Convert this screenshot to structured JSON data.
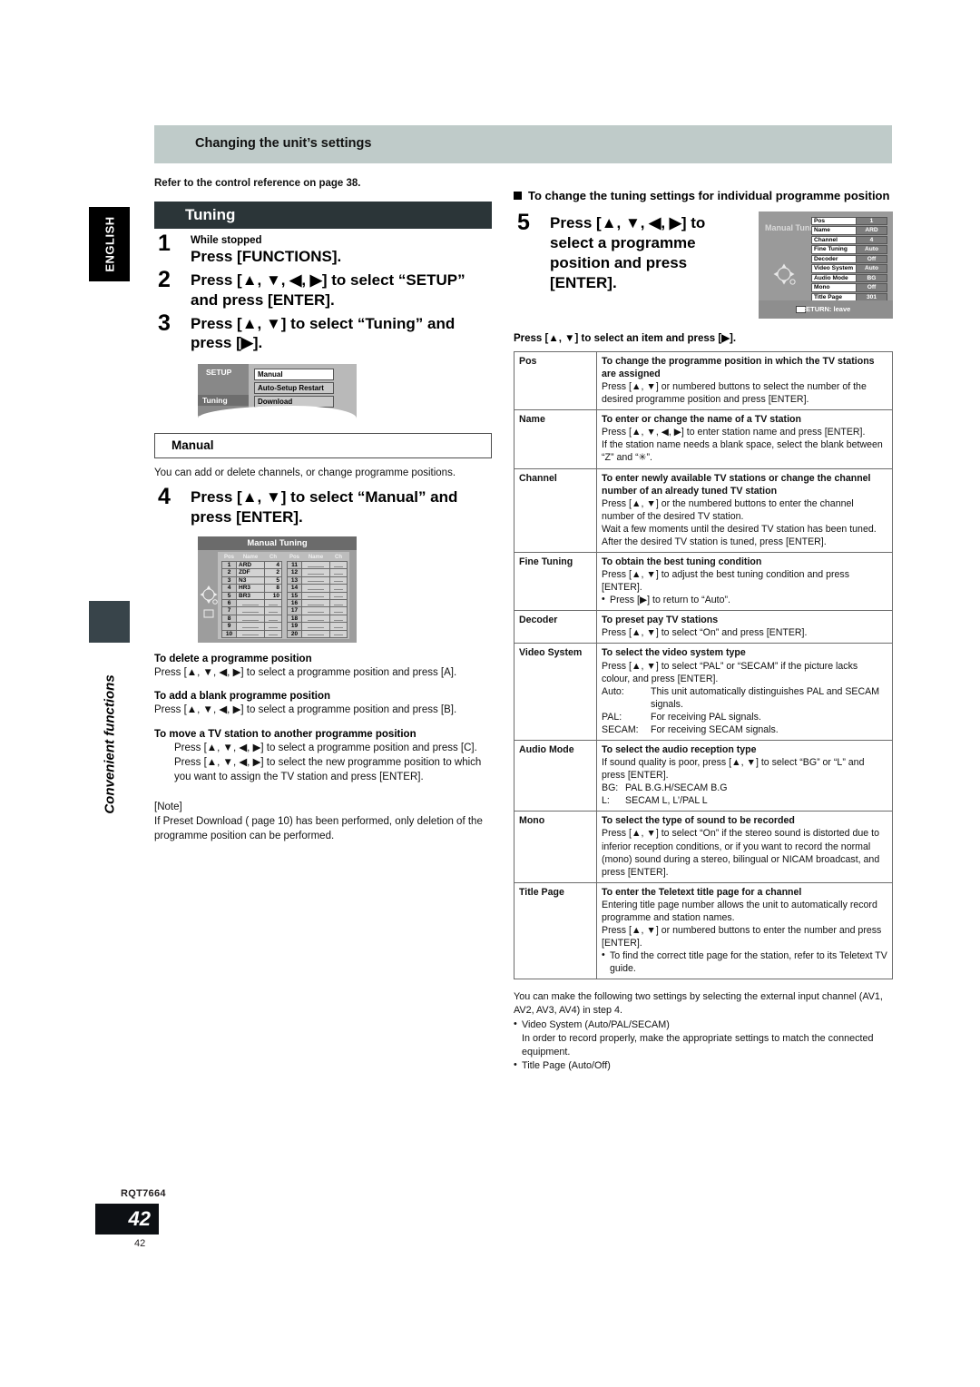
{
  "margin": {
    "language_tab": "ENGLISH",
    "chapter_label": "Convenient functions",
    "product_code": "RQT7664",
    "page_number": "42",
    "page_number_small": "42"
  },
  "header": {
    "band_title": "Changing the unit’s settings"
  },
  "left": {
    "reference_line": "Refer to the control reference on page 38.",
    "section_title": "Tuning",
    "steps": [
      {
        "num": "1",
        "sub": "While stopped",
        "text": "Press [FUNCTIONS]."
      },
      {
        "num": "2",
        "sub": "",
        "text": "Press [▲, ▼, ◀, ▶] to select “SETUP” and press [ENTER]."
      },
      {
        "num": "3",
        "sub": "",
        "text": "Press [▲, ▼] to select “Tuning” and press [▶]."
      }
    ],
    "setup_screen": {
      "title": "SETUP",
      "selected_category": "Tuning",
      "items": [
        "Manual",
        "Auto-Setup Restart",
        "Download"
      ]
    },
    "manual_box_title": "Manual",
    "manual_intro": "You can add or delete channels, or change programme positions.",
    "step4": {
      "num": "4",
      "text": "Press [▲, ▼] to select “Manual” and press [ENTER]."
    },
    "manual_tuning_screen": {
      "title": "Manual Tuning",
      "columns": [
        "Pos",
        "Name",
        "Ch"
      ],
      "rows_left": [
        {
          "pos": "1",
          "name": "ARD",
          "ch": "4"
        },
        {
          "pos": "2",
          "name": "ZDF",
          "ch": "2"
        },
        {
          "pos": "3",
          "name": "N3",
          "ch": "5"
        },
        {
          "pos": "4",
          "name": "HR3",
          "ch": "8"
        },
        {
          "pos": "5",
          "name": "BR3",
          "ch": "10"
        },
        {
          "pos": "6",
          "name": "",
          "ch": ""
        },
        {
          "pos": "7",
          "name": "",
          "ch": ""
        },
        {
          "pos": "8",
          "name": "",
          "ch": ""
        },
        {
          "pos": "9",
          "name": "",
          "ch": ""
        },
        {
          "pos": "10",
          "name": "",
          "ch": ""
        }
      ],
      "rows_right": [
        {
          "pos": "11",
          "name": "",
          "ch": ""
        },
        {
          "pos": "12",
          "name": "",
          "ch": ""
        },
        {
          "pos": "13",
          "name": "",
          "ch": ""
        },
        {
          "pos": "14",
          "name": "",
          "ch": ""
        },
        {
          "pos": "15",
          "name": "",
          "ch": ""
        },
        {
          "pos": "16",
          "name": "",
          "ch": ""
        },
        {
          "pos": "17",
          "name": "",
          "ch": ""
        },
        {
          "pos": "18",
          "name": "",
          "ch": ""
        },
        {
          "pos": "19",
          "name": "",
          "ch": ""
        },
        {
          "pos": "20",
          "name": "",
          "ch": ""
        }
      ]
    },
    "procedures": [
      {
        "heading": "To delete a programme position",
        "body": "Press [▲, ▼, ◀, ▶] to select a programme position and press [A]."
      },
      {
        "heading": "To add a blank programme position",
        "body": "Press [▲, ▼, ◀, ▶] to select a programme position and press [B]."
      },
      {
        "heading": "To move a TV station to another programme position",
        "body1": "Press [▲, ▼, ◀, ▶] to select a programme position and press [C].",
        "body2": "Press [▲, ▼, ◀, ▶] to select the new programme position to which you want to assign the TV station and press [ENTER]."
      }
    ],
    "note_label": "[Note]",
    "note_text": "If Preset Download (  page 10) has been performed, only deletion of the programme position can be performed."
  },
  "right": {
    "heading": "To change the tuning settings for individual programme position",
    "step5": {
      "num": "5",
      "text": "Press [▲, ▼, ◀, ▶] to select a programme position and press [ENTER]."
    },
    "tv_screen": {
      "title": "Manual Tuning",
      "settings": [
        {
          "key": "Pos",
          "value": "1"
        },
        {
          "key": "Name",
          "value": "ARD"
        },
        {
          "key": "Channel",
          "value": "4"
        },
        {
          "key": "Fine Tuning",
          "value": "Auto"
        },
        {
          "key": "Decoder",
          "value": "Off"
        },
        {
          "key": "Video System",
          "value": "Auto"
        },
        {
          "key": "Audio Mode",
          "value": "BG"
        },
        {
          "key": "Mono",
          "value": "Off"
        },
        {
          "key": "Title Page",
          "value": "301"
        }
      ],
      "footer": "RETURN:  leave"
    },
    "table_intro": "Press [▲, ▼] to select an item and press [▶].",
    "table": [
      {
        "key": "Pos",
        "title": "To change the programme position in which the TV stations are assigned",
        "lines": [
          "Press [▲, ▼] or numbered buttons to select the number of the desired programme position and press [ENTER]."
        ]
      },
      {
        "key": "Name",
        "title": "To enter or change the name of a TV station",
        "lines": [
          "Press [▲, ▼, ◀, ▶] to enter station name and press [ENTER].",
          "If the station name needs a blank space, select the blank between “Z” and “✳”."
        ]
      },
      {
        "key": "Channel",
        "title": "To enter newly available TV stations or change the channel number of an already tuned TV station",
        "lines": [
          "Press [▲, ▼] or the numbered buttons to enter the channel number of the desired TV station.",
          "Wait a few moments until the desired TV station has been tuned.",
          "After the desired TV station is tuned, press [ENTER]."
        ]
      },
      {
        "key": "Fine Tuning",
        "title": "To obtain the best tuning condition",
        "lines": [
          "Press [▲, ▼] to adjust the best tuning condition and press [ENTER]."
        ],
        "bullets": [
          "Press [▶] to return to “Auto”."
        ]
      },
      {
        "key": "Decoder",
        "title": "To preset pay TV stations",
        "lines": [
          "Press [▲, ▼] to select “On” and press [ENTER]."
        ]
      },
      {
        "key": "Video System",
        "title": "To select the video system type",
        "lines": [
          "Press [▲, ▼] to select “PAL” or “SECAM” if the picture lacks colour, and press [ENTER]."
        ],
        "defs": [
          {
            "term": "Auto:",
            "desc": "This unit automatically distinguishes PAL and SECAM signals."
          },
          {
            "term": "PAL:",
            "desc": "For receiving PAL signals."
          },
          {
            "term": "SECAM:",
            "desc": "For receiving SECAM signals."
          }
        ]
      },
      {
        "key": "Audio Mode",
        "title": "To select the audio reception type",
        "lines": [
          "If sound quality is poor, press [▲, ▼] to select “BG” or “L” and press [ENTER]."
        ],
        "defs": [
          {
            "term": "BG:",
            "desc": "PAL B.G.H/SECAM B.G"
          },
          {
            "term": "L:",
            "desc": "SECAM L, L’/PAL L"
          }
        ]
      },
      {
        "key": "Mono",
        "title": "To select the type of sound to be recorded",
        "lines": [
          "Press [▲, ▼] to select “On” if the stereo sound is distorted due to inferior reception conditions, or if you want to record the normal (mono) sound during a stereo, bilingual or NICAM broadcast, and press [ENTER]."
        ]
      },
      {
        "key": "Title Page",
        "title": "To enter the Teletext title page for a channel",
        "lines": [
          "Entering title page number allows the unit to automatically record programme and station names.",
          "Press [▲, ▼] or numbered buttons to enter the number and press [ENTER]."
        ],
        "bullets": [
          "To find the correct title page for the station, refer to its Teletext TV guide."
        ]
      }
    ],
    "tail": {
      "intro": "You can make the following two settings by selecting the external input channel (AV1, AV2, AV3, AV4) in step 4.",
      "item1": "Video System (Auto/PAL/SECAM)",
      "item1_desc": "In order to record properly, make the appropriate settings to match the connected equipment.",
      "item2": "Title Page (Auto/Off)"
    }
  }
}
